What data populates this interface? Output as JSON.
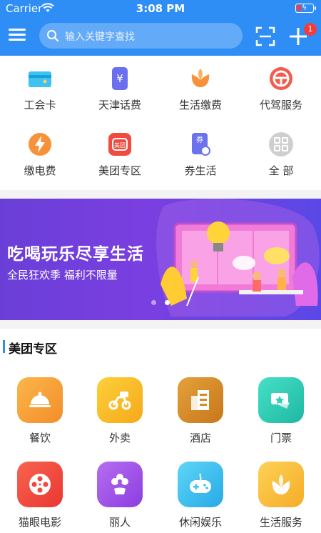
{
  "status_bar": {
    "carrier": "Carrier",
    "time": "3:08 PM"
  },
  "nav": {
    "search_placeholder": "输入关键字查找",
    "badge_count": "1"
  },
  "quick_services": [
    {
      "label": "工会卡",
      "icon": "union-card-icon"
    },
    {
      "label": "天津话费",
      "icon": "phone-bill-icon"
    },
    {
      "label": "生活缴费",
      "icon": "life-payment-icon"
    },
    {
      "label": "代驾服务",
      "icon": "driving-service-icon"
    },
    {
      "label": "缴电费",
      "icon": "electricity-icon"
    },
    {
      "label": "美团专区",
      "icon": "meituan-icon"
    },
    {
      "label": "券生活",
      "icon": "coupon-icon"
    },
    {
      "label": "全 部",
      "icon": "all-services-icon"
    }
  ],
  "banner": {
    "title": "吃喝玩乐尽享生活",
    "subtitle": "全民狂欢季 福利不限量",
    "dots": 2,
    "active_dot": 1
  },
  "meituan_section": {
    "title": "美团专区",
    "items": [
      {
        "label": "餐饮",
        "icon": "dining-icon",
        "color": "#f7a23a"
      },
      {
        "label": "外卖",
        "icon": "delivery-icon",
        "color": "#f7bd1e"
      },
      {
        "label": "酒店",
        "icon": "hotel-icon",
        "color": "#d98a22"
      },
      {
        "label": "门票",
        "icon": "ticket-icon",
        "color": "#2fd0b8"
      },
      {
        "label": "猫眼电影",
        "icon": "movie-icon",
        "color": "#f0483e"
      },
      {
        "label": "丽人",
        "icon": "beauty-icon",
        "color": "#a255e8"
      },
      {
        "label": "休闲娱乐",
        "icon": "game-icon",
        "color": "#3ec6f0"
      },
      {
        "label": "生活服务",
        "icon": "life-service-icon",
        "color": "#f9c23b"
      }
    ]
  },
  "colors": {
    "primary": "#2f8ef6",
    "badge": "#f53b3b"
  }
}
